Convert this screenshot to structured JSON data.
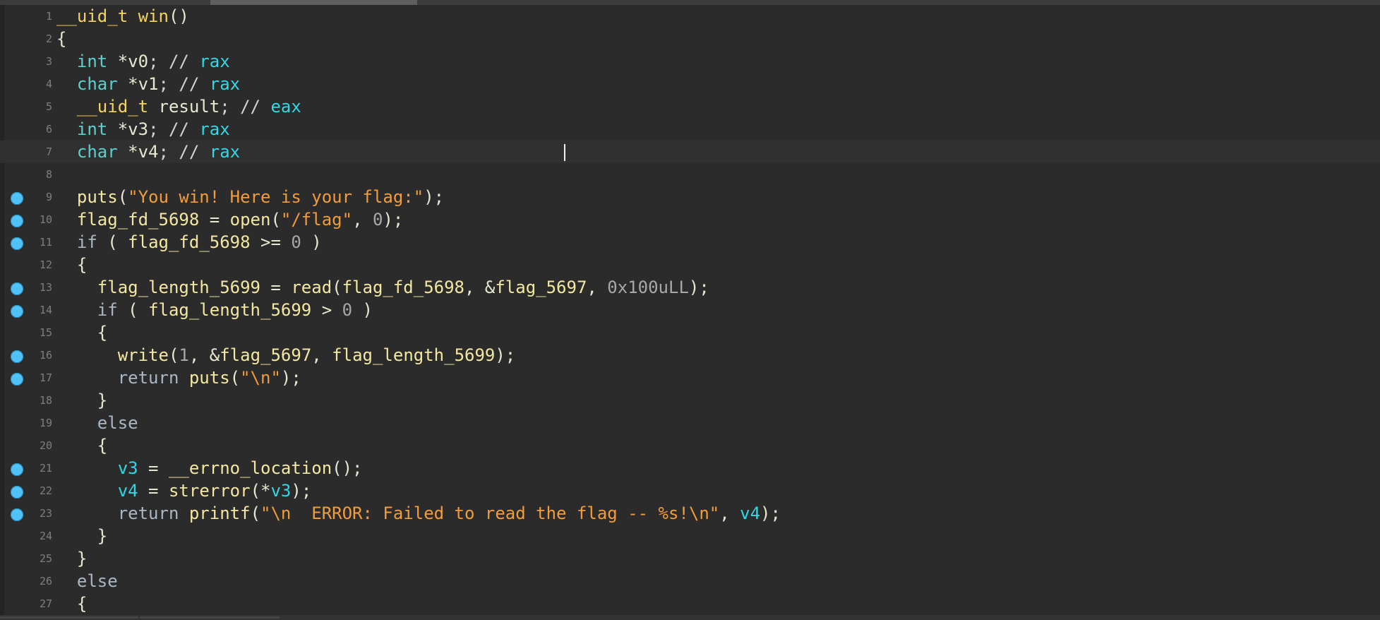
{
  "editor": {
    "lines": [
      {
        "n": "1",
        "bp": false,
        "tokens": [
          {
            "t": "__uid_t ",
            "c": "fn"
          },
          {
            "t": "win",
            "c": "fn"
          },
          {
            "t": "()",
            "c": "var"
          }
        ]
      },
      {
        "n": "2",
        "bp": false,
        "tokens": [
          {
            "t": "{",
            "c": "var"
          }
        ]
      },
      {
        "n": "3",
        "bp": false,
        "tokens": [
          {
            "t": "  ",
            "c": "var"
          },
          {
            "t": "int",
            "c": "ty"
          },
          {
            "t": " *",
            "c": "var"
          },
          {
            "t": "v0",
            "c": "var"
          },
          {
            "t": "; // ",
            "c": "cmt"
          },
          {
            "t": "rax",
            "c": "reg"
          }
        ]
      },
      {
        "n": "4",
        "bp": false,
        "tokens": [
          {
            "t": "  ",
            "c": "var"
          },
          {
            "t": "char",
            "c": "ty"
          },
          {
            "t": " *",
            "c": "var"
          },
          {
            "t": "v1",
            "c": "var"
          },
          {
            "t": "; // ",
            "c": "cmt"
          },
          {
            "t": "rax",
            "c": "reg"
          }
        ]
      },
      {
        "n": "5",
        "bp": false,
        "tokens": [
          {
            "t": "  ",
            "c": "var"
          },
          {
            "t": "__uid_t ",
            "c": "fn"
          },
          {
            "t": "result",
            "c": "var"
          },
          {
            "t": "; // ",
            "c": "cmt"
          },
          {
            "t": "eax",
            "c": "reg"
          }
        ]
      },
      {
        "n": "6",
        "bp": false,
        "tokens": [
          {
            "t": "  ",
            "c": "var"
          },
          {
            "t": "int",
            "c": "ty"
          },
          {
            "t": " *",
            "c": "var"
          },
          {
            "t": "v3",
            "c": "var"
          },
          {
            "t": "; // ",
            "c": "cmt"
          },
          {
            "t": "rax",
            "c": "reg"
          }
        ]
      },
      {
        "n": "7",
        "bp": false,
        "current": true,
        "tokens": [
          {
            "t": "  ",
            "c": "var"
          },
          {
            "t": "char",
            "c": "ty"
          },
          {
            "t": " *",
            "c": "var"
          },
          {
            "t": "v4",
            "c": "var"
          },
          {
            "t": "; // ",
            "c": "cmt"
          },
          {
            "t": "rax",
            "c": "reg"
          }
        ]
      },
      {
        "n": "8",
        "bp": false,
        "tokens": []
      },
      {
        "n": "9",
        "bp": true,
        "tokens": [
          {
            "t": "  ",
            "c": "var"
          },
          {
            "t": "puts",
            "c": "gvar"
          },
          {
            "t": "(",
            "c": "var"
          },
          {
            "t": "\"You win! Here is your flag:\"",
            "c": "str"
          },
          {
            "t": ");",
            "c": "var"
          }
        ]
      },
      {
        "n": "10",
        "bp": true,
        "tokens": [
          {
            "t": "  ",
            "c": "var"
          },
          {
            "t": "flag_fd_5698",
            "c": "gvar"
          },
          {
            "t": " = ",
            "c": "var"
          },
          {
            "t": "open",
            "c": "gvar"
          },
          {
            "t": "(",
            "c": "var"
          },
          {
            "t": "\"/flag\"",
            "c": "str"
          },
          {
            "t": ", ",
            "c": "var"
          },
          {
            "t": "0",
            "c": "num"
          },
          {
            "t": ");",
            "c": "var"
          }
        ]
      },
      {
        "n": "11",
        "bp": true,
        "tokens": [
          {
            "t": "  ",
            "c": "var"
          },
          {
            "t": "if",
            "c": "kw"
          },
          {
            "t": " ( ",
            "c": "var"
          },
          {
            "t": "flag_fd_5698",
            "c": "gvar"
          },
          {
            "t": " >= ",
            "c": "var"
          },
          {
            "t": "0",
            "c": "num"
          },
          {
            "t": " )",
            "c": "var"
          }
        ]
      },
      {
        "n": "12",
        "bp": false,
        "tokens": [
          {
            "t": "  {",
            "c": "var"
          }
        ]
      },
      {
        "n": "13",
        "bp": true,
        "tokens": [
          {
            "t": "    ",
            "c": "var"
          },
          {
            "t": "flag_length_5699",
            "c": "gvar"
          },
          {
            "t": " = ",
            "c": "var"
          },
          {
            "t": "read",
            "c": "gvar"
          },
          {
            "t": "(",
            "c": "var"
          },
          {
            "t": "flag_fd_5698",
            "c": "gvar"
          },
          {
            "t": ", &",
            "c": "var"
          },
          {
            "t": "flag_5697",
            "c": "gvar"
          },
          {
            "t": ", ",
            "c": "var"
          },
          {
            "t": "0x100uLL",
            "c": "num"
          },
          {
            "t": ");",
            "c": "var"
          }
        ]
      },
      {
        "n": "14",
        "bp": true,
        "tokens": [
          {
            "t": "    ",
            "c": "var"
          },
          {
            "t": "if",
            "c": "kw"
          },
          {
            "t": " ( ",
            "c": "var"
          },
          {
            "t": "flag_length_5699",
            "c": "gvar"
          },
          {
            "t": " > ",
            "c": "var"
          },
          {
            "t": "0",
            "c": "num"
          },
          {
            "t": " )",
            "c": "var"
          }
        ]
      },
      {
        "n": "15",
        "bp": false,
        "tokens": [
          {
            "t": "    {",
            "c": "var"
          }
        ]
      },
      {
        "n": "16",
        "bp": true,
        "tokens": [
          {
            "t": "      ",
            "c": "var"
          },
          {
            "t": "write",
            "c": "gvar"
          },
          {
            "t": "(",
            "c": "var"
          },
          {
            "t": "1",
            "c": "num"
          },
          {
            "t": ", &",
            "c": "var"
          },
          {
            "t": "flag_5697",
            "c": "gvar"
          },
          {
            "t": ", ",
            "c": "var"
          },
          {
            "t": "flag_length_5699",
            "c": "gvar"
          },
          {
            "t": ");",
            "c": "var"
          }
        ]
      },
      {
        "n": "17",
        "bp": true,
        "tokens": [
          {
            "t": "      ",
            "c": "var"
          },
          {
            "t": "return",
            "c": "kw"
          },
          {
            "t": " ",
            "c": "var"
          },
          {
            "t": "puts",
            "c": "gvar"
          },
          {
            "t": "(",
            "c": "var"
          },
          {
            "t": "\"\\n\"",
            "c": "str"
          },
          {
            "t": ");",
            "c": "var"
          }
        ]
      },
      {
        "n": "18",
        "bp": false,
        "tokens": [
          {
            "t": "    }",
            "c": "var"
          }
        ]
      },
      {
        "n": "19",
        "bp": false,
        "tokens": [
          {
            "t": "    ",
            "c": "var"
          },
          {
            "t": "else",
            "c": "kw"
          }
        ]
      },
      {
        "n": "20",
        "bp": false,
        "tokens": [
          {
            "t": "    {",
            "c": "var"
          }
        ]
      },
      {
        "n": "21",
        "bp": true,
        "tokens": [
          {
            "t": "      ",
            "c": "var"
          },
          {
            "t": "v3",
            "c": "reg"
          },
          {
            "t": " = ",
            "c": "var"
          },
          {
            "t": "__errno_location",
            "c": "gvar"
          },
          {
            "t": "();",
            "c": "var"
          }
        ]
      },
      {
        "n": "22",
        "bp": true,
        "tokens": [
          {
            "t": "      ",
            "c": "var"
          },
          {
            "t": "v4",
            "c": "reg"
          },
          {
            "t": " = ",
            "c": "var"
          },
          {
            "t": "strerror",
            "c": "gvar"
          },
          {
            "t": "(*",
            "c": "var"
          },
          {
            "t": "v3",
            "c": "reg"
          },
          {
            "t": ");",
            "c": "var"
          }
        ]
      },
      {
        "n": "23",
        "bp": true,
        "tokens": [
          {
            "t": "      ",
            "c": "var"
          },
          {
            "t": "return",
            "c": "kw"
          },
          {
            "t": " ",
            "c": "var"
          },
          {
            "t": "printf",
            "c": "gvar"
          },
          {
            "t": "(",
            "c": "var"
          },
          {
            "t": "\"\\n  ERROR: Failed to read the flag -- %s!\\n\"",
            "c": "str"
          },
          {
            "t": ", ",
            "c": "var"
          },
          {
            "t": "v4",
            "c": "reg"
          },
          {
            "t": ");",
            "c": "var"
          }
        ]
      },
      {
        "n": "24",
        "bp": false,
        "tokens": [
          {
            "t": "    }",
            "c": "var"
          }
        ]
      },
      {
        "n": "25",
        "bp": false,
        "tokens": [
          {
            "t": "  }",
            "c": "var"
          }
        ]
      },
      {
        "n": "26",
        "bp": false,
        "tokens": [
          {
            "t": "  ",
            "c": "var"
          },
          {
            "t": "else",
            "c": "kw"
          }
        ]
      },
      {
        "n": "27",
        "bp": false,
        "tokens": [
          {
            "t": "  {",
            "c": "var"
          }
        ]
      }
    ],
    "breakpoint_color": "#4fc3f7",
    "background_color": "#2b2b2b",
    "caret_line": "7"
  }
}
